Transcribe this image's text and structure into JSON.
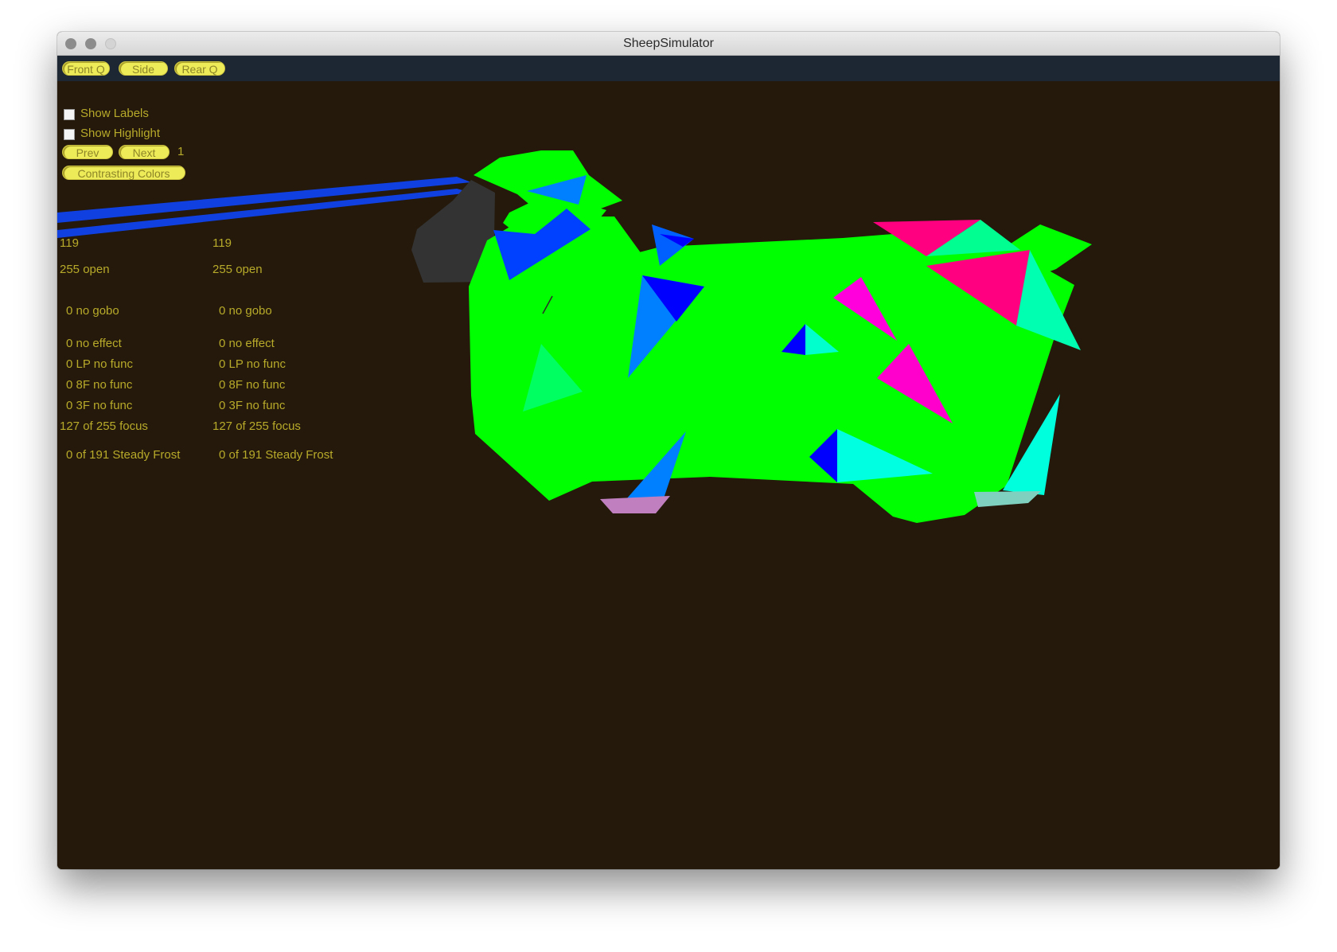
{
  "window": {
    "title": "SheepSimulator"
  },
  "toolbar": {
    "front_label": "Front Q",
    "side_label": "Side",
    "rear_label": "Rear Q"
  },
  "controls": {
    "show_labels": "Show Labels",
    "show_highlight": "Show Highlight",
    "prev_label": "Prev",
    "next_label": "Next",
    "page_number": "1",
    "contrasting_colors": "Contrasting Colors"
  },
  "fixtures": [
    {
      "channel": "119",
      "open": "255 open",
      "gobo": "0 no gobo",
      "effect": "0 no effect",
      "lp": "0 LP no func",
      "f8": "0 8F no func",
      "f3": "0 3F no func",
      "focus": "127 of 255 focus",
      "frost": "0 of 191 Steady Frost"
    },
    {
      "channel": "119",
      "open": "255 open",
      "gobo": "0 no gobo",
      "effect": "0 no effect",
      "lp": "0 LP no func",
      "f8": "0 8F no func",
      "f3": "0 3F no func",
      "focus": "127 of 255 focus",
      "frost": "0 of 191 Steady Frost"
    }
  ],
  "colors": {
    "background": "#24190a",
    "toolbar": "#1c2733",
    "button": "#eeeb58",
    "label_text": "#b8aa2a",
    "body_green": "#00ff00",
    "beam_blue": "#1040e0"
  }
}
